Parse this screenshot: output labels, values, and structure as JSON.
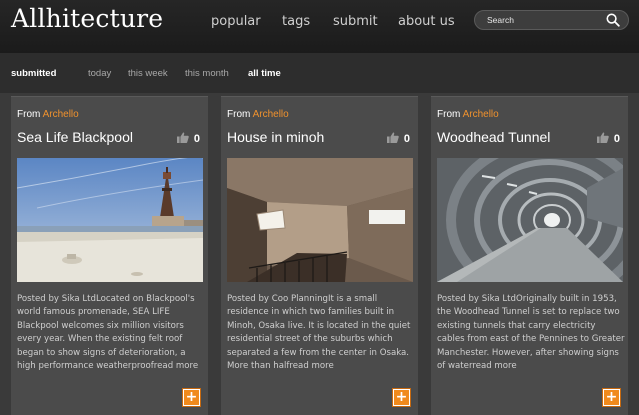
{
  "site": {
    "logo": "Allhitecture"
  },
  "nav": [
    {
      "label": "popular"
    },
    {
      "label": "tags"
    },
    {
      "label": "submit"
    },
    {
      "label": "about us"
    }
  ],
  "search": {
    "placeholder": "Search",
    "icon": "search-icon"
  },
  "filters": {
    "submitted": "submitted",
    "today": "today",
    "this_week": "this week",
    "this_month": "this month",
    "all_time": "all time",
    "active": "all time"
  },
  "cards": [
    {
      "from_label": "From",
      "author": "Archello",
      "title": "Sea Life Blackpool",
      "likes": "0",
      "excerpt": "Posted by Sika LtdLocated on Blackpool's world famous promenade, SEA LIFE Blackpool welcomes six million visitors every year. When the existing felt roof began to show signs of deterioration, a high performance weatherproofread more",
      "add_label": "+"
    },
    {
      "from_label": "From",
      "author": "Archello",
      "title": "House in minoh",
      "likes": "0",
      "excerpt": "Posted by Coo PlanningIt is a small residence in which two families built in Minoh, Osaka live. It is located in the quiet residential street of the suburbs which separated a few from the center in Osaka. More than halfread more",
      "add_label": "+"
    },
    {
      "from_label": "From",
      "author": "Archello",
      "title": "Woodhead Tunnel",
      "likes": "0",
      "excerpt": "Posted by Sika LtdOriginally built in 1953, the Woodhead Tunnel is set to replace two existing tunnels that carry electricity cables from east of the Pennines to Greater Manchester. However, after showing signs of waterread more",
      "add_label": "+"
    }
  ],
  "colors": {
    "accent": "#f0922e",
    "header_bg": "#1e1e1e",
    "card_bg": "#4b4b4b",
    "page_bg": "#3a3a3a"
  }
}
